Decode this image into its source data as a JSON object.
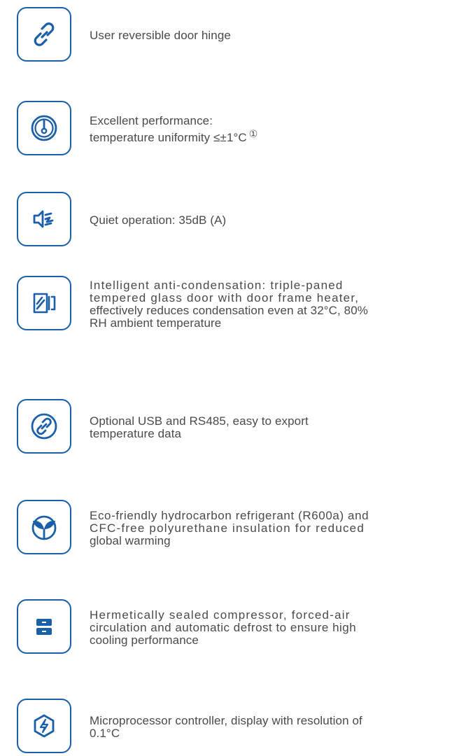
{
  "colors": {
    "accent": "#1a5fa8",
    "text": "#4a4a4a"
  },
  "features": [
    {
      "icon": "link-icon",
      "lines": [
        "User reversible door hinge"
      ]
    },
    {
      "icon": "thermometer-gauge-icon",
      "lines": [
        "Excellent performance:",
        "temperature uniformity ≤±1°C"
      ],
      "footnote": "①"
    },
    {
      "icon": "speaker-sound-icon",
      "lines": [
        "Quiet operation: 35dB (A)"
      ]
    },
    {
      "icon": "glass-door-icon",
      "lines": [
        "Intelligent anti-condensation: triple-paned",
        "tempered glass door with door frame heater,",
        "effectively reduces condensation even at 32°C, 80%",
        "RH ambient temperature"
      ]
    },
    {
      "icon": "link-circle-icon",
      "lines": [
        "Optional USB and RS485, easy to export",
        "temperature data"
      ]
    },
    {
      "icon": "eco-leaf-icon",
      "lines": [
        "Eco-friendly hydrocarbon refrigerant (R600a) and",
        "CFC-free polyurethane insulation for reduced",
        "global warming"
      ]
    },
    {
      "icon": "compressor-icon",
      "lines": [
        "Hermetically sealed compressor, forced-air",
        "circulation and automatic defrost to ensure high",
        "cooling performance"
      ]
    },
    {
      "icon": "lightning-hexagon-icon",
      "lines": [
        "Microprocessor controller, display with resolution of",
        "0.1°C"
      ]
    }
  ]
}
